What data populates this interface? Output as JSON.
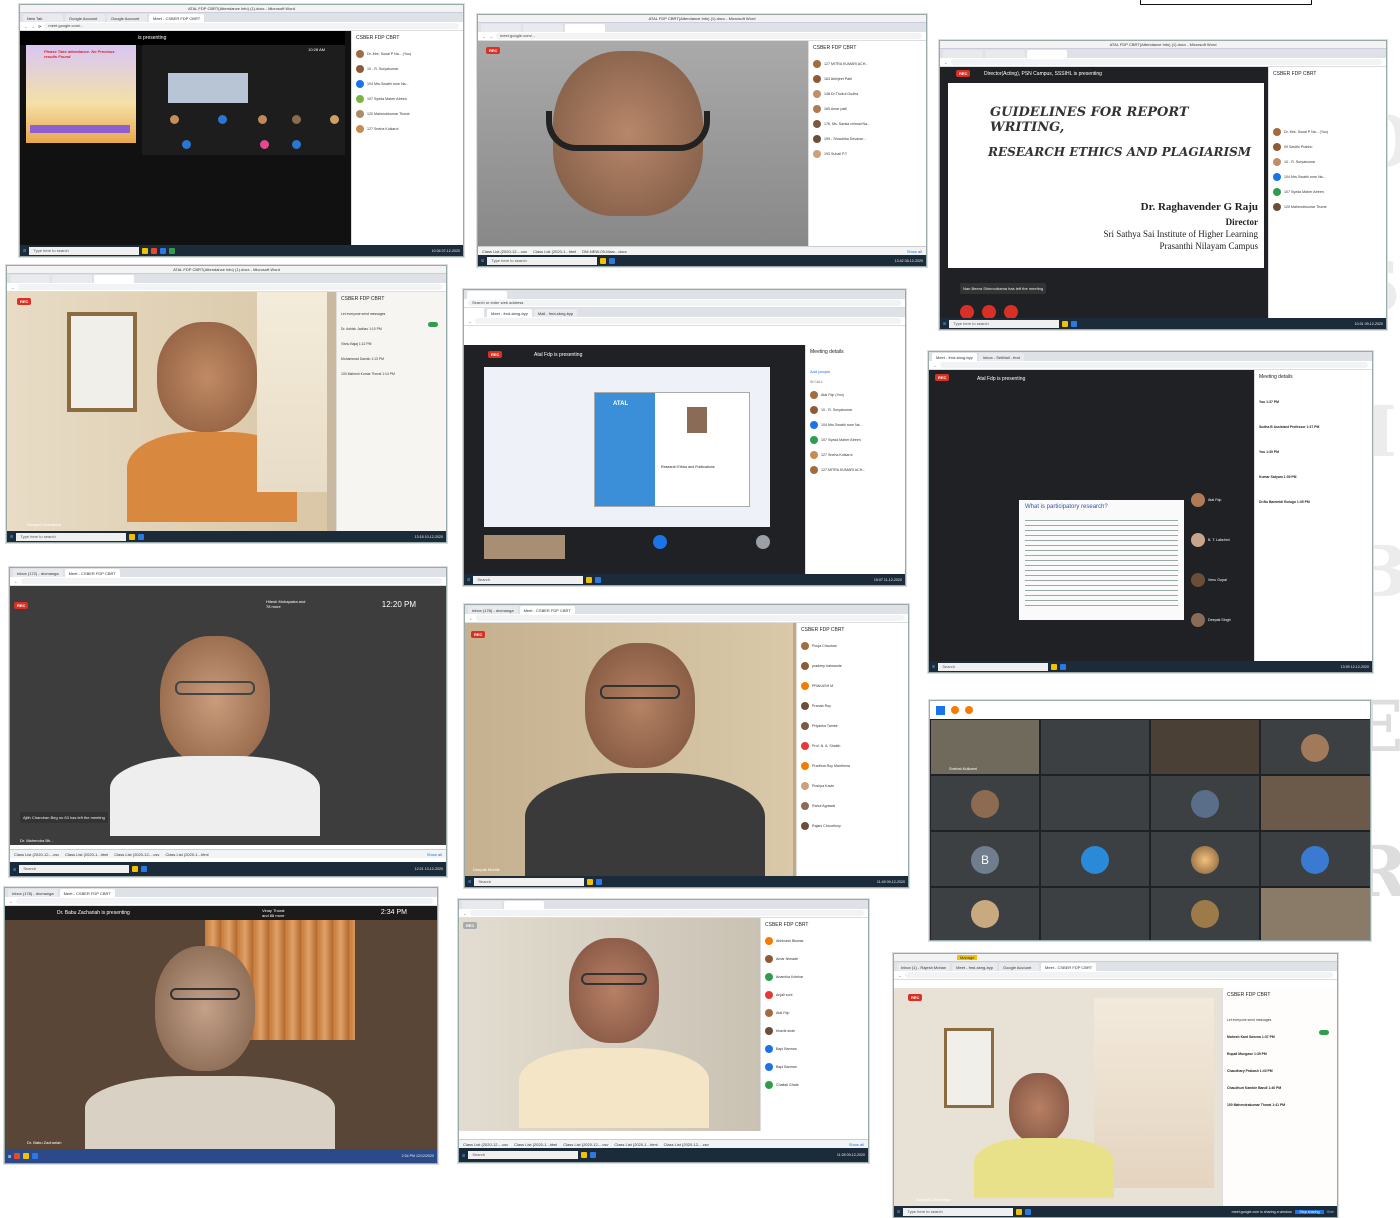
{
  "top_right_box": "",
  "side_letters": [
    "O",
    "S",
    "I",
    "B",
    "E",
    "R"
  ],
  "shot1": {
    "wintitle": "ATAL FDP CBRT(Attendance Info) (1).docx - Microsoft Word",
    "tabs": [
      "New Tab",
      "Google Account",
      "Google Account",
      "Meet - CSBER FDP CBRT"
    ],
    "url": "meet.google.com/...",
    "presenting": "is presenting",
    "panel_title": "CSBER FDP CBRT",
    "slide_note": "Please Take attendance. No Previous results Found",
    "participants": [
      "Dr. Mrs. Sonal P Na... (You)",
      "10 - R. Suryakumar",
      "104 Mrs.Swathi rone Na...",
      "107 Syeda Maher Afreen",
      "120 Mahendrkumar Thorat",
      "127 Sneha Kulkarni"
    ],
    "clock": "10:28 AM",
    "taskbar_search": "Type here to search",
    "taskbar_time": "10:34\n07-12-2020"
  },
  "shot2": {
    "wintitle": "ATAL FDP CBRT(Attendance Info) (1).docx - Microsoft Word",
    "url": "meet.google.com/...",
    "rec": "REC",
    "panel_title": "CSBER FDP CBRT",
    "participants": [
      "127 MITRA KUMARI ACH...",
      "163 Abhijeet Patil",
      "148 Dr.Thukul Gudha",
      "165 Amar patil",
      "176. Ms. Sarala chinnal Na...",
      "199 - Shraddha Devarse...",
      "193 Suhail P.T"
    ],
    "downloads": [
      "Class List (2020-12-...csv",
      "Class List (2020-1...html",
      "DM-NEW-09-Marc...docx"
    ],
    "show_all": "Show all",
    "taskbar_search": "Type here to search",
    "taskbar_time": "13:42\n08-12-2020"
  },
  "shot3": {
    "wintitle": "ATAL FDP CBRT(Attendance Info) (1).docx - Microsoft Word",
    "rec": "REC",
    "presenting": "Director(Acting), PSN Campus, SSSIHL is presenting",
    "panel_title": "CSBER FDP CBRT",
    "slide_title_1": "GUIDELINES FOR REPORT WRITING,",
    "slide_title_2": "RESEARCH ETHICS AND PLAGIARISM",
    "speaker_name": "Dr. Raghavender G Raju",
    "speaker_role": "Director",
    "speaker_inst_1": "Sri Sathya Sai Institute of Higher Learning",
    "speaker_inst_2": "Prasanthi Nilayam Campus",
    "toast": "Nan Beera Shinnodrama has left the meeting",
    "participants": [
      "Dr. Mrs. Sonal P Na... (You)",
      "09 Savithi Prabhu",
      "10 - R. Suryakumar",
      "104 Mrs.Swathi rone Na...",
      "107 Syeda Maher Afreen",
      "120 Mahendrkumar Thorat"
    ],
    "taskbar_search": "Type here to search",
    "taskbar_time": "10:31\n09-12-2020"
  },
  "shot4": {
    "wintitle": "ATAL FDP CBRT(Attendance Info) (1).docx - Microsoft Word",
    "rec": "REC",
    "panel_title": "CSBER FDP CBRT",
    "name_tag": "Swapnil Chandekar",
    "chat": [
      "Let everyone send messages",
      "Dr. Ashish Jadhav 1:10 PM",
      "Vishu Bajaj 1:12 PM",
      "Mohammad Danish 1:13 PM",
      "100 Mahesh Kumar Thorat 1:14 PM"
    ],
    "taskbar_search": "Type here to search",
    "taskbar_time": "13:18\n10-12-2020"
  },
  "shot5": {
    "tabs": [
      "Meet - fmd-sbng-byp",
      "Mail - fmd-sbng-byp"
    ],
    "search_ph": "Search or enter web address",
    "rec": "REC",
    "presenting": "Atal Fdp is presenting",
    "panel_title": "Meeting details",
    "add_people": "Add people",
    "in_call": "IN CALL",
    "participants": [
      "Atal Fdp (You)",
      "10 - R. Suryakumar",
      "104 Mrs.Swathi rone Na...",
      "107 Syeda Maher Afreen",
      "127 Sneha Kulkarni",
      "127 MITRA KUMARI ACH..."
    ],
    "slide_org": "ATAL",
    "slide_sub": "Research Ethics and Publications",
    "taskbar_search": "Search",
    "taskbar_time": "15:07\n11-12-2020"
  },
  "shot6": {
    "tabs": [
      "Meet - fmd-sbng-byp",
      "Inbox - SetMail - fmd"
    ],
    "rec": "REC",
    "presenting": "Atal Fdp is presenting",
    "panel_title": "Meeting details",
    "slide_heading": "What is participatory research?",
    "chat": [
      "You 1:37 PM",
      "Sudha B Assistant Professor 1:37 PM",
      "You 1:39 PM",
      "Kumar Satyam 1:39 PM",
      "Dr.Bu Bammidi Bulugu 1:39 PM"
    ],
    "tiles": [
      "Atal Fdp",
      "B. T. Lakshmi",
      "Venu Gopal",
      "Deepak Singh"
    ],
    "taskbar_search": "Search",
    "taskbar_time": "13:39\n12-12-2020"
  },
  "shot7": {
    "tabs": [
      "Inbox (172) - drcmanga",
      "Meet - CSBER FDP CBRT"
    ],
    "rec": "REC",
    "top_right_text": "Hitesh Mohapatra and 78 more",
    "clock": "12:20 PM",
    "toast": "Ajith Chandran Beg no 63 has left the meeting",
    "name_tag": "Dr. Mahendra Bh...",
    "downloads": [
      "Class List (2020-12-...csv",
      "Class List (2020-1...html",
      "Class List (2020-12-...csv",
      "Class List (2020-1...html"
    ],
    "show_all": "Show all",
    "taskbar_search": "Search",
    "taskbar_time": "12:21\n13-12-2020"
  },
  "shot8": {
    "tabs": [
      "Inbox (178) - drcmanga",
      "Meet - CSBER FDP CBRT"
    ],
    "rec": "REC",
    "panel_title": "CSBER FDP CBRT",
    "participants": [
      "Pooja Chauhan",
      "pradeep hatwande",
      "PRAKASH M",
      "Pranab Roy",
      "Priyanka Tambe",
      "Prof. N. A. Shaikh",
      "Pradhna Roy Manthena",
      "Pushpa Kavin",
      "Rahul Agrawal",
      "Rajani Choudhury"
    ],
    "name_tag": "Deepak Mohite",
    "taskbar_search": "Search",
    "taskbar_time": "11:49\n09-12-2020"
  },
  "shot9": {
    "tiles": [
      "Snehal Kulkarni",
      "B"
    ]
  },
  "shot10": {
    "tabs": [
      "Inbox (178) - drcmanga",
      "Meet - CSBER FDP CBRT"
    ],
    "presenting": "Dr. Babu Zachariah is presenting",
    "top_right_text": "Vinay Thorat and 88 more",
    "clock": "2:34 PM",
    "name_tag": "Dr. Babu Zachariah",
    "taskbar_time": "2:34 PM\n12/12/2020"
  },
  "shot11": {
    "rec": "REC",
    "panel_title": "CSBER FDP CBRT",
    "participants": [
      "Abhinash Biswas",
      "Amar Nimade",
      "Anamika Kolekar",
      "Anjali soni",
      "Atal Fdp",
      "bhavik shah",
      "Bapi Barman",
      "Bapi Barman",
      "Chaitali Ghate"
    ],
    "downloads": [
      "Class List (2020-12-...csv",
      "Class List (2020-1...html",
      "Class List (2020-12-...csv",
      "Class List (2020-1...html",
      "Class List (2020-12-...csv"
    ],
    "show_all": "Show all",
    "taskbar_search": "Search",
    "taskbar_time": "11:28\n09-12-2020"
  },
  "shot12": {
    "manage_label": "Manage",
    "tabs": [
      "Inbox (1) - Rajesh Mohan",
      "Meet - fmd-sbng-byp",
      "Google Account",
      "Meet - CSBER FDP CBRT"
    ],
    "rec": "REC",
    "panel_title": "CSBER FDP CBRT",
    "chat": [
      "Let everyone send messages",
      "Mahesh Kant Saxena 1:37 PM",
      "Rupali Mungase 1:39 PM",
      "Chaudhary Prakash 1:40 PM",
      "Chaudhuri Kamble Bandi 1:40 PM",
      "100 Mahendrakumar Thorat 1:41 PM"
    ],
    "name_tag": "Swapnil Chandekar",
    "share_text": "meet.google.com is sharing a window.",
    "stop_sharing": "Stop sharing",
    "hide": "Hide",
    "taskbar_search": "Type here to search",
    "taskbar_time": "13:45\n13-12-2020"
  }
}
